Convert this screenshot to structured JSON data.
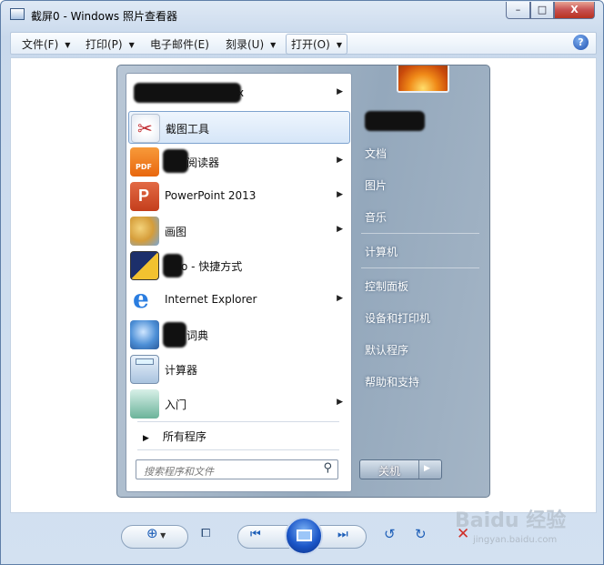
{
  "window": {
    "title": "截屏0 - Windows 照片查看器",
    "min": "–",
    "max": "□",
    "close": "X"
  },
  "menubar": {
    "file": "文件(F)",
    "print": "打印(P)",
    "email": "电子邮件(E)",
    "burn": "刻录(U)",
    "open": "打开(O)",
    "help": "?"
  },
  "start_menu": {
    "programs": [
      {
        "label": "x",
        "has_sub": true
      },
      {
        "label": "截图工具",
        "has_sub": false,
        "selected": true
      },
      {
        "label": "阅读器",
        "has_sub": true
      },
      {
        "label": "PowerPoint 2013",
        "has_sub": true
      },
      {
        "label": "画图",
        "has_sub": true
      },
      {
        "label": "o - 快捷方式",
        "has_sub": false
      },
      {
        "label": "Internet Explorer",
        "has_sub": true
      },
      {
        "label": "词典",
        "has_sub": false
      },
      {
        "label": "计算器",
        "has_sub": false
      },
      {
        "label": "入门",
        "has_sub": true
      }
    ],
    "all_programs": "所有程序",
    "search_placeholder": "搜索程序和文件",
    "right": [
      {
        "label": "文档"
      },
      {
        "label": "图片"
      },
      {
        "label": "音乐"
      },
      {
        "label": "计算机"
      },
      {
        "label": "控制面板"
      },
      {
        "label": "设备和打印机"
      },
      {
        "label": "默认程序"
      },
      {
        "label": "帮助和支持"
      }
    ],
    "shutdown": "关机",
    "submenu_arrow": "▶"
  },
  "watermark": {
    "brand": "Baidu 经验",
    "url": "jingyan.baidu.com"
  }
}
